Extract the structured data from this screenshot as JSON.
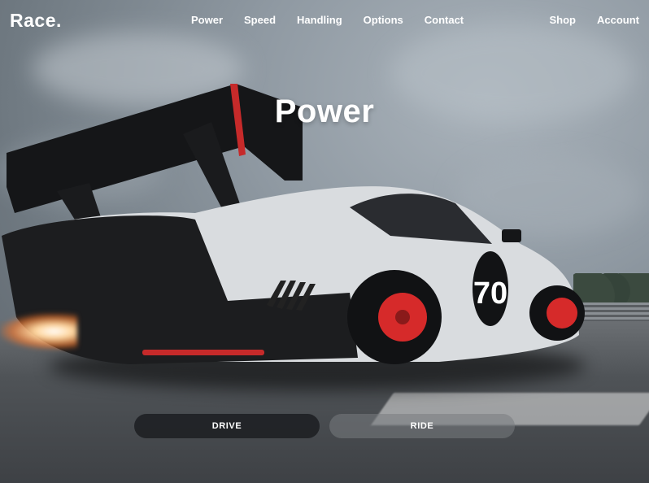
{
  "brand": {
    "name": "Race."
  },
  "nav": {
    "links": [
      "Power",
      "Speed",
      "Handling",
      "Options",
      "Contact"
    ],
    "right": [
      "Shop",
      "Account"
    ]
  },
  "hero": {
    "title": "Power",
    "car_number": "70"
  },
  "buttons": {
    "drive": "DRIVE",
    "ride": "RIDE"
  },
  "colors": {
    "accent_red": "#d62a2a",
    "button_dark": "#1e2023",
    "text": "#ffffff"
  }
}
